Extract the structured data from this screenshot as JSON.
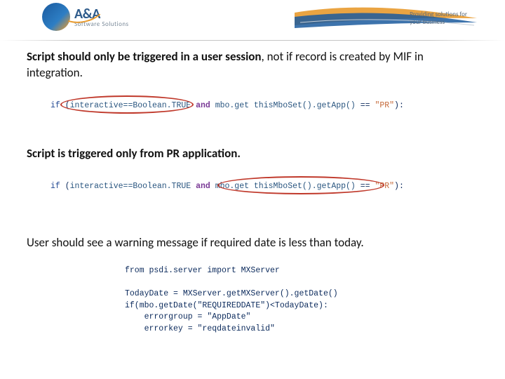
{
  "header": {
    "logo_main": "A&A",
    "logo_sub": "Software Solutions",
    "tagline_line1": "Providing solutions for",
    "tagline_line2": "your business"
  },
  "para1": {
    "bold": "Script should only be triggered in a user session",
    "rest": ", not if record is created by MIF in integration."
  },
  "code1": {
    "if": "if",
    "lp": "(",
    "expr1": "interactive==Boolean.TRUE",
    "and": "and",
    "expr2a": "mbo.get thisMboSet().getApp()",
    "eq": " == ",
    "str": "\"PR\"",
    "rp": "):"
  },
  "para2": "Script is triggered only from PR application.",
  "code2": {
    "if": "if",
    "lp": "(",
    "expr1": "interactive==Boolean.TRUE",
    "and": "and",
    "expr2a": "mbo.get thisMboSet().getApp()",
    "eq": " == ",
    "str": "\"PR\"",
    "rp": "):"
  },
  "para3": "User should see a warning message if required date is less than today.",
  "codeblock": "from psdi.server import MXServer\n\nTodayDate = MXServer.getMXServer().getDate()\nif(mbo.getDate(\"REQUIREDDATE\")<TodayDate):\n    errorgroup = \"AppDate\"\n    errorkey = \"reqdateinvalid\""
}
